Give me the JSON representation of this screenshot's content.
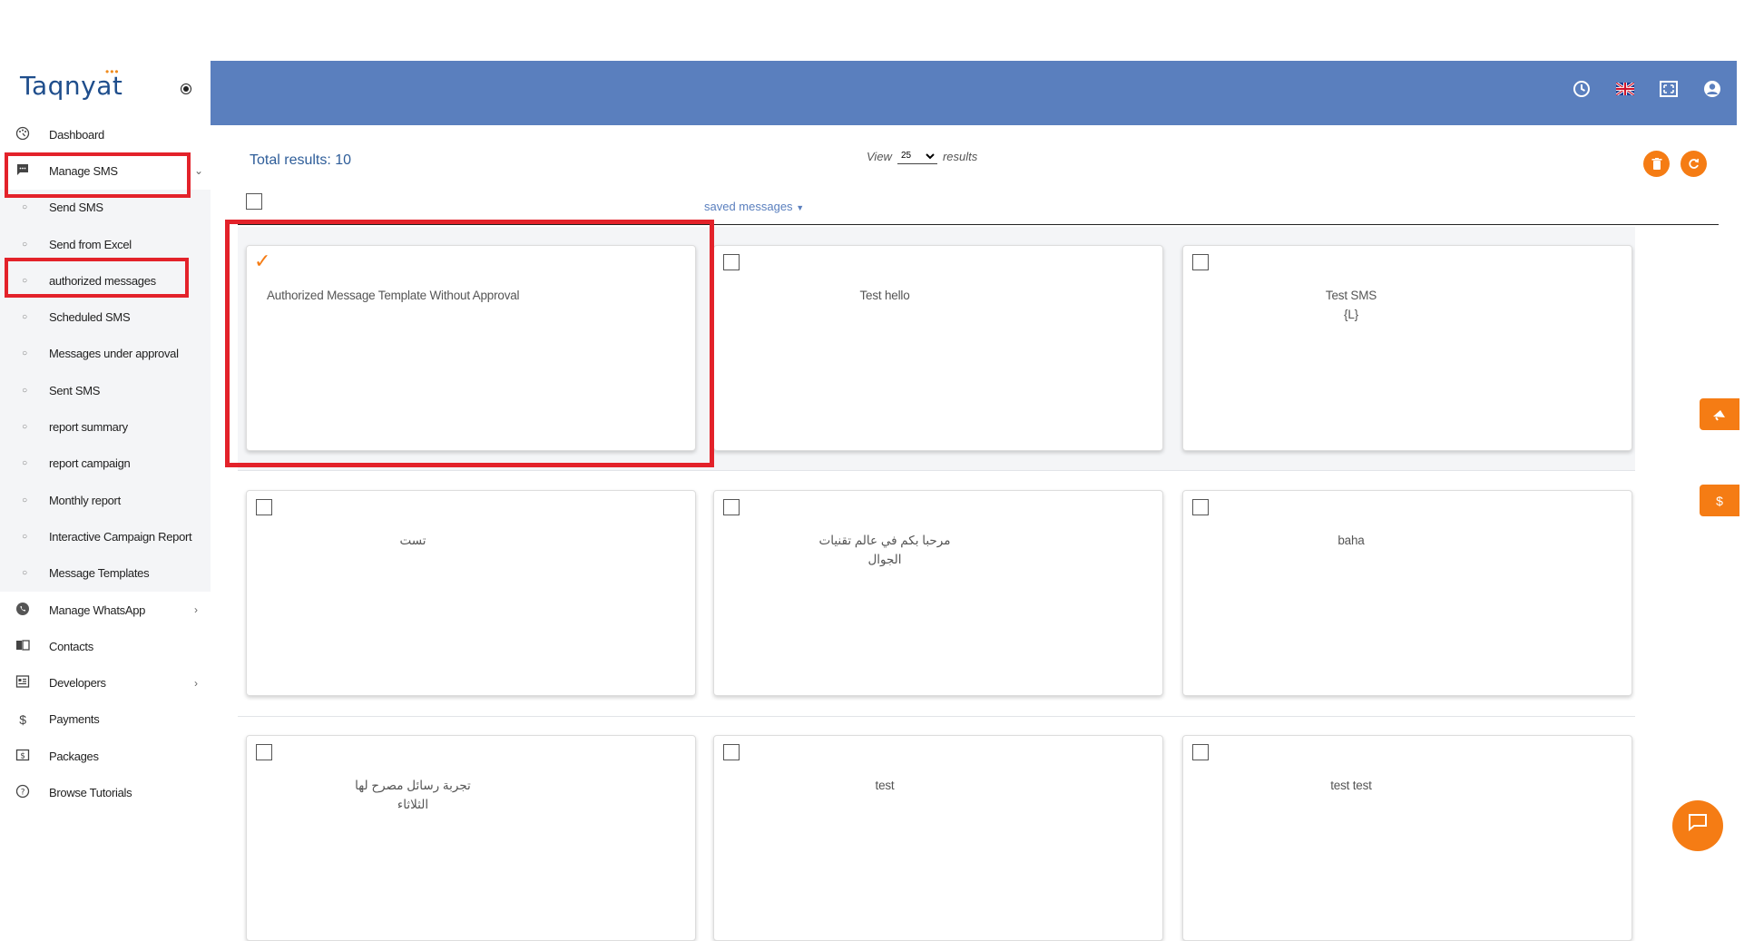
{
  "brand": {
    "logo_text": "Taqnyat",
    "logo_dots": "•••"
  },
  "sidebar": {
    "items": [
      {
        "label": "Dashboard",
        "icon": "dashboard-icon"
      },
      {
        "label": "Manage SMS",
        "icon": "sms-icon",
        "expanded": true
      },
      {
        "label": "Send SMS",
        "icon": "circle-icon"
      },
      {
        "label": "Send from Excel",
        "icon": "circle-icon"
      },
      {
        "label": "authorized messages",
        "icon": "circle-icon"
      },
      {
        "label": "Scheduled SMS",
        "icon": "circle-icon"
      },
      {
        "label": "Messages under approval",
        "icon": "circle-icon"
      },
      {
        "label": "Sent SMS",
        "icon": "circle-icon"
      },
      {
        "label": "report summary",
        "icon": "circle-icon"
      },
      {
        "label": "report campaign",
        "icon": "circle-icon"
      },
      {
        "label": "Monthly report",
        "icon": "circle-icon"
      },
      {
        "label": "Interactive Campaign Report",
        "icon": "circle-icon"
      },
      {
        "label": "Message Templates",
        "icon": "circle-icon"
      },
      {
        "label": "Manage WhatsApp",
        "icon": "whatsapp-icon"
      },
      {
        "label": "Contacts",
        "icon": "contacts-icon"
      },
      {
        "label": "Developers",
        "icon": "developers-icon"
      },
      {
        "label": "Payments",
        "icon": "dollar-icon"
      },
      {
        "label": "Packages",
        "icon": "packages-icon"
      },
      {
        "label": "Browse Tutorials",
        "icon": "help-icon"
      }
    ]
  },
  "header": {
    "icons": [
      "clock-icon",
      "uk-flag-icon",
      "fullscreen-icon",
      "user-icon"
    ]
  },
  "content": {
    "total_results": "Total results: 10",
    "view_label": "View",
    "view_value": "25",
    "results_label": "results",
    "tab_label": "saved messages",
    "cards": [
      {
        "text": "Authorized Message Template Without Approval",
        "checked": true
      },
      {
        "text": "Test hello",
        "checked": false
      },
      {
        "text": "Test SMS\n{L}",
        "checked": false
      },
      {
        "text": "تست",
        "checked": false
      },
      {
        "text": "مرحبا بكم في عالم تقنيات\nالجوال",
        "checked": false
      },
      {
        "text": "baha",
        "checked": false
      },
      {
        "text": "تجربة رسائل مصرح لها\nالثلاثاء",
        "checked": false
      },
      {
        "text": "test",
        "checked": false
      },
      {
        "text": "test test",
        "checked": false
      }
    ]
  },
  "colors": {
    "header_bg": "#5a7fbe",
    "accent_orange": "#f57c14",
    "highlight_red": "#e3222a",
    "brand_blue": "#1f4e8c"
  }
}
